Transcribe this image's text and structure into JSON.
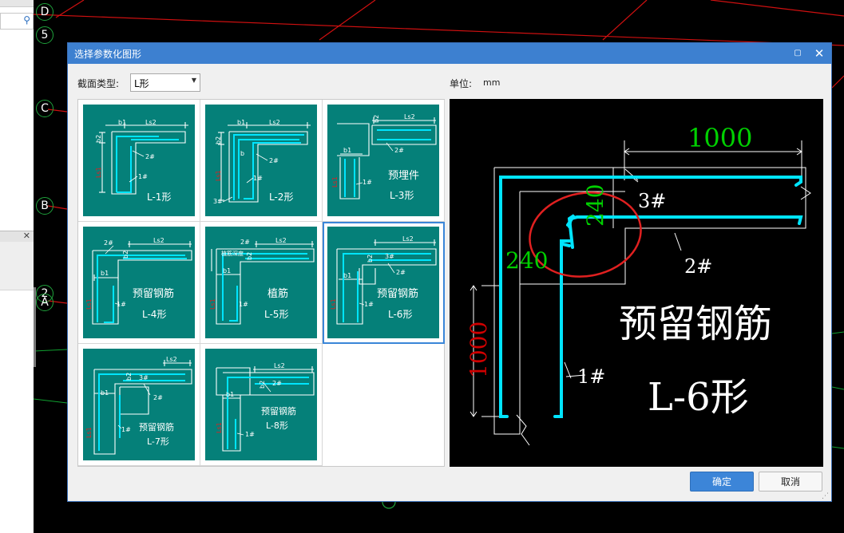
{
  "background": {
    "axis_labels": [
      "D",
      "5",
      "C",
      "B",
      "2",
      "A"
    ]
  },
  "dialog": {
    "title": "选择参数化图形",
    "section_type_label": "截面类型:",
    "section_type_value": "L形",
    "unit_label": "单位:",
    "unit_value": "mm",
    "ok_label": "确定",
    "cancel_label": "取消",
    "selected_shape": "L-6形"
  },
  "shapes": [
    {
      "name": "L-1形",
      "extra": ""
    },
    {
      "name": "L-2形",
      "extra": ""
    },
    {
      "name": "L-3形",
      "extra": "预埋件"
    },
    {
      "name": "L-4形",
      "extra": "预留钢筋"
    },
    {
      "name": "L-5形",
      "extra": "植筋"
    },
    {
      "name": "L-6形",
      "extra": "预留钢筋"
    },
    {
      "name": "L-7形",
      "extra": "预留钢筋"
    },
    {
      "name": "L-8形",
      "extra": "预留钢筋"
    }
  ],
  "thumb_labels": {
    "b1": "b1",
    "b2": "b2",
    "b": "b",
    "ls1": "Ls1",
    "ls2": "Ls2",
    "bar1": "1#",
    "bar2": "2#",
    "bar3": "3#",
    "anchor_depth": "植筋深度"
  },
  "preview": {
    "dim_top": "1000",
    "dim_vertical": "240",
    "dim_horizontal": "240",
    "dim_left": "1000",
    "bar3": "3#",
    "bar2": "2#",
    "bar1": "1#",
    "title": "预留钢筋",
    "shape_name": "L-6形"
  },
  "colors": {
    "titlebar": "#3d80d0",
    "thumb_bg": "#058079",
    "rebar": "#00e5ff",
    "dim_green": "#00d000",
    "dim_red": "#d00000",
    "marker_red": "#e02020"
  }
}
